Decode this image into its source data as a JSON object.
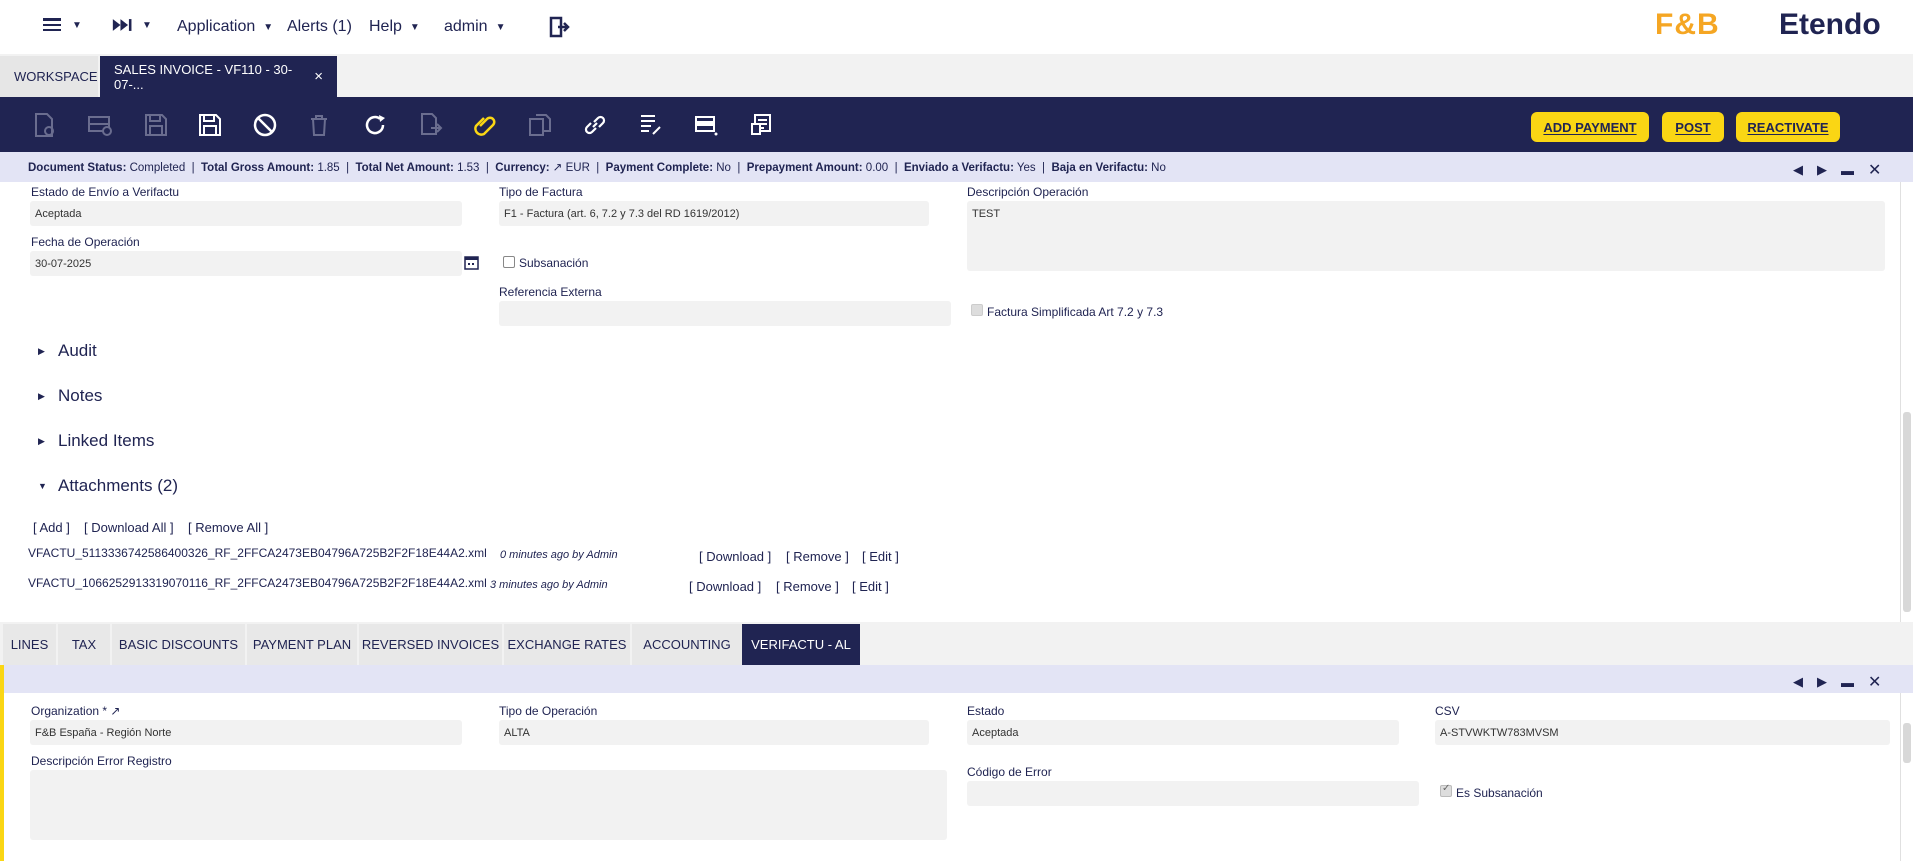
{
  "nav": {
    "application": "Application",
    "alerts": "Alerts (1)",
    "help": "Help",
    "user": "admin",
    "brand_fb": "F&B",
    "brand_name": "Etendo"
  },
  "tabs": {
    "workspace": "WORKSPACE",
    "active": "SALES INVOICE - VF110 - 30-07-...",
    "close": "×"
  },
  "toolbar": {
    "add_payment": "ADD PAYMENT",
    "post": "POST",
    "reactivate": "REACTIVATE"
  },
  "status": {
    "doc_status_label": "Document Status:",
    "doc_status": "Completed",
    "gross_label": "Total Gross Amount:",
    "gross": "1.85",
    "net_label": "Total Net Amount:",
    "net": "1.53",
    "currency_label": "Currency:",
    "currency": "EUR",
    "payment_complete_label": "Payment Complete:",
    "payment_complete": "No",
    "prepayment_label": "Prepayment Amount:",
    "prepayment": "0.00",
    "enviado_label": "Enviado a Verifactu:",
    "enviado": "Yes",
    "baja_label": "Baja en Verifactu:",
    "baja": "No"
  },
  "form": {
    "estado_envio_label": "Estado de Envío a Verifactu",
    "estado_envio": "Aceptada",
    "tipo_factura_label": "Tipo de Factura",
    "tipo_factura": "F1 - Factura (art. 6, 7.2 y 7.3 del RD 1619/2012)",
    "descripcion_label": "Descripción Operación",
    "descripcion": "TEST",
    "fecha_label": "Fecha de Operación",
    "fecha": "30-07-2025",
    "subsanacion_label": "Subsanación",
    "referencia_label": "Referencia Externa",
    "referencia": "",
    "simplificada_label": "Factura Simplificada Art 7.2 y 7.3"
  },
  "sections": {
    "audit": "Audit",
    "notes": "Notes",
    "linked": "Linked Items",
    "attachments": "Attachments (2)"
  },
  "attachments": {
    "add": "[ Add ]",
    "download_all": "[ Download All ]",
    "remove_all": "[ Remove All ]",
    "download": "[ Download ]",
    "remove": "[ Remove ]",
    "edit": "[ Edit ]",
    "items": [
      {
        "name": "VFACTU_5113336742586400326_RF_2FFCA2473EB04796A725B2F2F18E44A2.xml",
        "meta": "0 minutes ago by Admin"
      },
      {
        "name": "VFACTU_1066252913319070116_RF_2FFCA2473EB04796A725B2F2F18E44A2.xml",
        "meta": "3 minutes ago by Admin"
      }
    ]
  },
  "bottom_tabs": [
    "LINES",
    "TAX",
    "BASIC DISCOUNTS",
    "PAYMENT PLAN",
    "REVERSED INVOICES",
    "EXCHANGE RATES",
    "ACCOUNTING",
    "VERIFACTU - AL"
  ],
  "sub": {
    "org_label": "Organization *",
    "org": "F&B España - Región Norte",
    "tipo_op_label": "Tipo de Operación",
    "tipo_op": "ALTA",
    "estado_label": "Estado",
    "estado": "Aceptada",
    "csv_label": "CSV",
    "csv": "A-STVWKTW783MVSM",
    "desc_error_label": "Descripción Error Registro",
    "desc_error": "",
    "codigo_label": "Código de Error",
    "codigo": "",
    "es_subsanacion_label": "Es Subsanación"
  },
  "colors": {
    "navy": "#202452",
    "yellow": "#fad614",
    "status_bg": "#e3e4f5"
  }
}
